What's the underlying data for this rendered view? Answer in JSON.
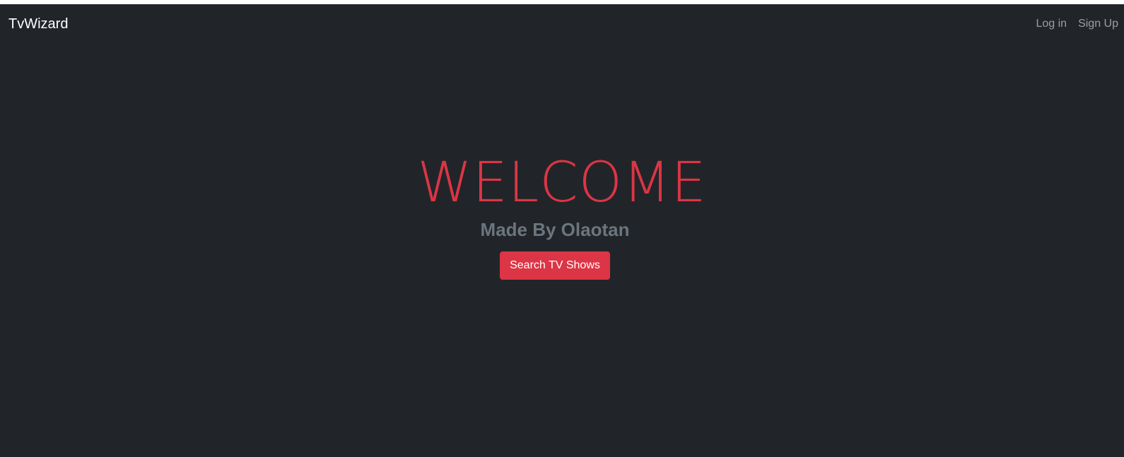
{
  "navbar": {
    "brand": "TvWizard",
    "links": [
      "Log in",
      "Sign Up"
    ]
  },
  "hero": {
    "title": "WELCOME",
    "subtitle": "Made By Olaotan",
    "button_label": "Search TV Shows"
  },
  "colors": {
    "background": "#212529",
    "accent": "#dc3545",
    "muted": "#6c757d"
  }
}
